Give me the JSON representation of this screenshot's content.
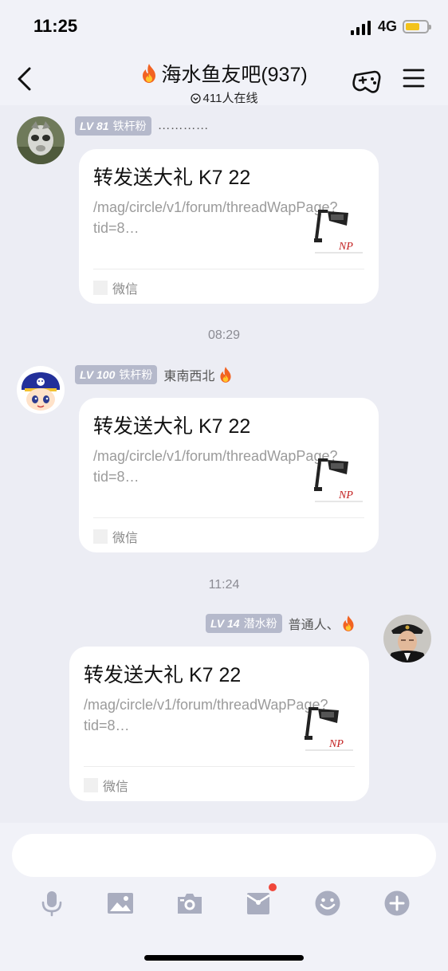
{
  "status_bar": {
    "time": "11:25",
    "network": "4G"
  },
  "header": {
    "title": "海水鱼友吧(937)",
    "subtitle": "411人在线",
    "icons": [
      "chevron-left-icon",
      "flame-icon",
      "game-controller-icon",
      "menu-icon"
    ]
  },
  "messages": [
    {
      "level_prefix": "LV 81",
      "level_title": "铁杆粉",
      "nickname": "…………",
      "card_title": "转发送大礼 K7 22",
      "card_url": "/mag/circle/v1/forum/threadWapPage?tid=8…",
      "card_source": "微信",
      "show_flame": false
    },
    {
      "level_prefix": "LV 100",
      "level_title": "铁杆粉",
      "nickname": "東南西北",
      "card_title": "转发送大礼 K7 22",
      "card_url": "/mag/circle/v1/forum/threadWapPage?tid=8…",
      "card_source": "微信",
      "show_flame": true
    },
    {
      "level_prefix": "LV 14",
      "level_title": "潜水粉",
      "nickname": "普通人、",
      "card_title": "转发送大礼 K7 22",
      "card_url": "/mag/circle/v1/forum/threadWapPage?tid=8…",
      "card_source": "微信",
      "show_flame": true
    }
  ],
  "timestamps": [
    "08:29",
    "11:24"
  ],
  "input": {
    "placeholder": "",
    "tools": [
      "microphone-icon",
      "image-icon",
      "camera-icon",
      "red-packet-icon",
      "emoji-icon",
      "plus-icon"
    ]
  },
  "colors": {
    "background": "#ecedf4",
    "level_badge": "#b5b9cb",
    "notification_dot": "#f0473b",
    "flame": "#f26322"
  }
}
